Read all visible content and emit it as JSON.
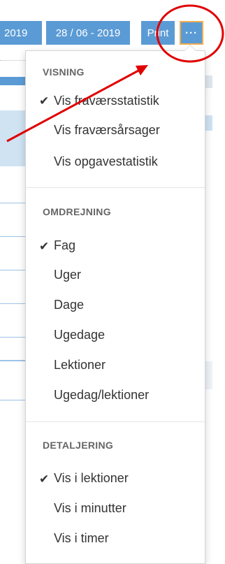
{
  "toolbar": {
    "date_from": "2019",
    "date_to": "28 / 06 - 2019",
    "print_label": "Print",
    "more_label": "···"
  },
  "background": {
    "percent_fragment": "%"
  },
  "menu": {
    "visning": {
      "heading": "VISNING",
      "items": [
        {
          "label": "Vis fraværsstatistik",
          "checked": true
        },
        {
          "label": "Vis fraværsårsager",
          "checked": false
        },
        {
          "label": "Vis opgavestatistik",
          "checked": false
        }
      ]
    },
    "omdrejning": {
      "heading": "OMDREJNING",
      "items": [
        {
          "label": "Fag",
          "checked": true
        },
        {
          "label": "Uger",
          "checked": false
        },
        {
          "label": "Dage",
          "checked": false
        },
        {
          "label": "Ugedage",
          "checked": false
        },
        {
          "label": "Lektioner",
          "checked": false
        },
        {
          "label": "Ugedag/lektioner",
          "checked": false
        }
      ]
    },
    "detaljering": {
      "heading": "DETALJERING",
      "items": [
        {
          "label": "Vis i lektioner",
          "checked": true
        },
        {
          "label": "Vis i minutter",
          "checked": false
        },
        {
          "label": "Vis i timer",
          "checked": false
        }
      ]
    },
    "check_glyph": "✔"
  },
  "colors": {
    "button_blue": "#5b9bd5",
    "active_border": "#f0ad4e",
    "annotation_red": "#e00000"
  }
}
